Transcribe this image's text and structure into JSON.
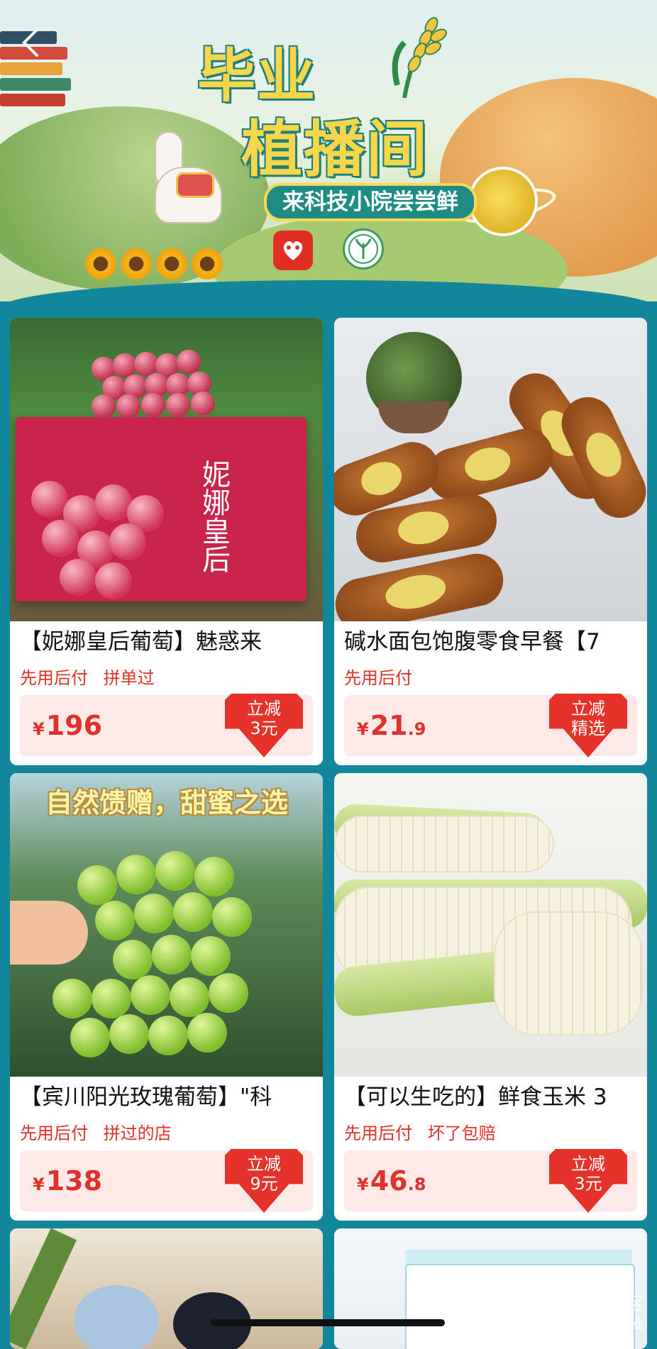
{
  "header": {
    "back_icon": "chevron-left-icon",
    "title_line1": "毕业",
    "title_line2": "植播间",
    "subtitle": "来科技小院尝尝鲜"
  },
  "products": [
    {
      "title": "【妮娜皇后葡萄】魅惑来",
      "tags": [
        "先用后付",
        "拼单过"
      ],
      "price_symbol": "¥",
      "price_int": "196",
      "price_dec": "",
      "badge_top": "立减",
      "badge_bottom": "3元",
      "image_text": "妮娜皇后"
    },
    {
      "title": "碱水面包饱腹零食早餐【7",
      "tags": [
        "先用后付"
      ],
      "price_symbol": "¥",
      "price_int": "21",
      "price_dec": ".9",
      "badge_top": "立减",
      "badge_bottom": "精选"
    },
    {
      "title": "【宾川阳光玫瑰葡萄】\"科",
      "tags": [
        "先用后付",
        "拼过的店"
      ],
      "price_symbol": "¥",
      "price_int": "138",
      "price_dec": "",
      "badge_top": "立减",
      "badge_bottom": "9元",
      "image_text": "自然馈赠，甜蜜之选"
    },
    {
      "title": "【可以生吃的】鲜食玉米 3",
      "tags": [
        "先用后付",
        "坏了包赔"
      ],
      "price_symbol": "¥",
      "price_int": "46",
      "price_dec": ".8",
      "badge_top": "立减",
      "badge_bottom": "3元"
    }
  ],
  "watermark": {
    "line1": "老虎社区",
    "line2": "@极点商业"
  },
  "colors": {
    "background": "#12869a",
    "accent_red": "#e0322a",
    "price_bar": "#fde9e7"
  }
}
